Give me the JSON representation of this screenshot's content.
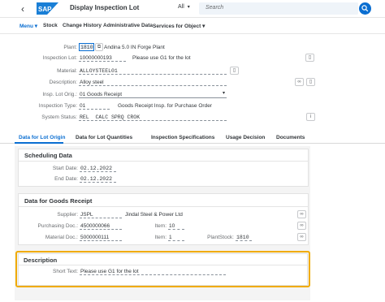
{
  "shell": {
    "back_glyph": "‹",
    "logo_text": "SAP",
    "title": "Display Inspection Lot",
    "scope": "All",
    "search_placeholder": "Search"
  },
  "toolbar": {
    "menu": "Menu",
    "stock": "Stock",
    "change_history": "Change History",
    "admin_data": "Administrative Data",
    "services": "Services for Object"
  },
  "header": {
    "plant_label": "Plant:",
    "plant_value": "1810",
    "plant_desc": "Andina 5.0 IN Forge Plant",
    "lot_label": "Inspection Lot:",
    "lot_value": "10000000193",
    "lot_note": "Please use G1 for the lot",
    "material_label": "Material:",
    "material_value": "ALLOYSTEEL01",
    "desc_label": "Description:",
    "desc_value": "Alloy steel",
    "origin_label": "Insp. Lot Orig.:",
    "origin_value": "01 Goods Receipt",
    "type_label": "Inspection Type:",
    "type_value": "01",
    "type_desc": "Goods Receipt Insp. for Purchase Order",
    "status_label": "System Status:",
    "status_value": "REL  CALC SPRQ CROK"
  },
  "tabs": [
    "Data for Lot Origin",
    "Data for Lot Quantities",
    "Inspection Specifications",
    "Usage Decision",
    "Documents"
  ],
  "scheduling": {
    "title": "Scheduling Data",
    "start_label": "Start Date:",
    "start_value": "02.12.2022",
    "end_label": "End Date:",
    "end_value": "02.12.2022"
  },
  "goods_receipt": {
    "title": "Data for Goods Receipt",
    "supplier_label": "Supplier:",
    "supplier_value": "JSPL",
    "supplier_name": "Jindal Steel & Power Ltd",
    "po_label": "Purchasing Doc.:",
    "po_value": "4500000066",
    "item_label": "Item:",
    "po_item": "10",
    "matdoc_label": "Material Doc.:",
    "matdoc_value": "5000000111",
    "matdoc_item": "1",
    "plantstock_label": "PlantStock:",
    "plantstock_value": "1810"
  },
  "description": {
    "title": "Description",
    "short_label": "Short Text:",
    "short_value": "Please use G1 for the lot"
  },
  "colors": {
    "accent": "#0a6ed1",
    "highlight": "#f0ab00"
  }
}
